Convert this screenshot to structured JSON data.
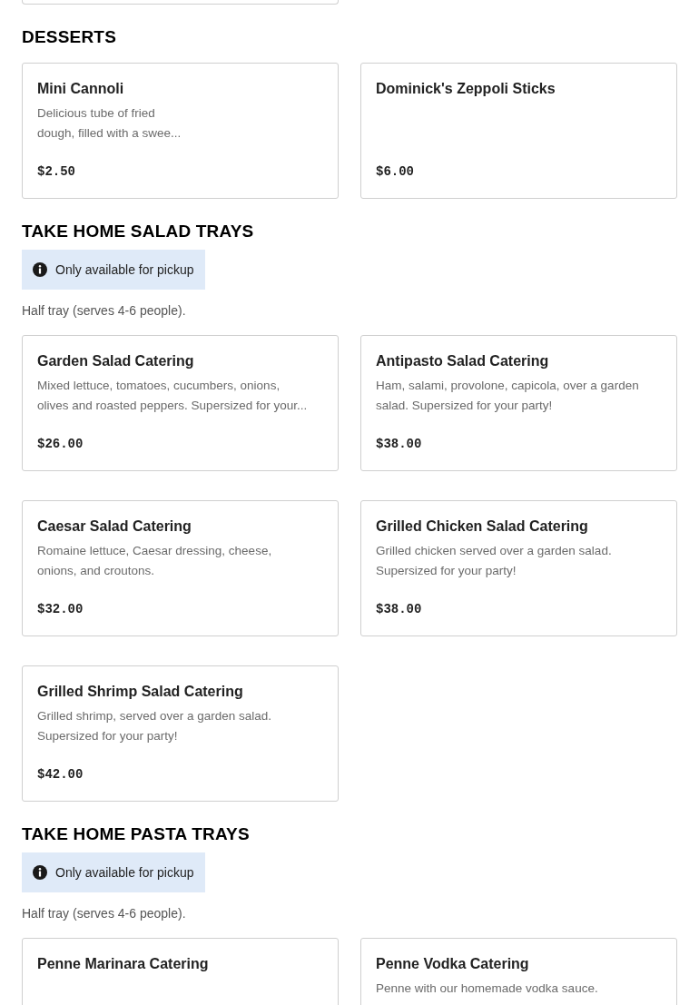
{
  "sections": [
    {
      "title": "DESSERTS",
      "items": [
        {
          "name": "Mini Cannoli",
          "description_lines": [
            "Delicious tube of fried",
            "dough, filled with a swee..."
          ],
          "price": "$2.50"
        },
        {
          "name": "Dominick's Zeppoli Sticks",
          "price": "$6.00"
        }
      ]
    },
    {
      "title": "TAKE HOME SALAD TRAYS",
      "notice": "Only available for pickup",
      "note": "Half tray (serves 4-6 people).",
      "items": [
        {
          "name": "Garden Salad Catering",
          "description_lines": [
            "Mixed lettuce, tomatoes, cucumbers, onions,",
            "olives and roasted peppers. Supersized for your..."
          ],
          "price": "$26.00"
        },
        {
          "name": "Antipasto Salad Catering",
          "description_lines": [
            "Ham, salami, provolone, capicola, over a garden",
            "salad. Supersized for your party!"
          ],
          "price": "$38.00"
        },
        {
          "name": "Caesar Salad Catering",
          "description_lines": [
            "Romaine lettuce, Caesar dressing, cheese,",
            "onions, and croutons."
          ],
          "price": "$32.00"
        },
        {
          "name": "Grilled Chicken Salad Catering",
          "description_lines": [
            "Grilled chicken served over a garden salad.",
            "Supersized for your party!"
          ],
          "price": "$38.00"
        },
        {
          "name": "Grilled Shrimp Salad Catering",
          "description_lines": [
            "Grilled shrimp, served over a garden salad.",
            "Supersized for your party!"
          ],
          "price": "$42.00"
        }
      ]
    },
    {
      "title": "TAKE HOME PASTA TRAYS",
      "notice": "Only available for pickup",
      "note": "Half tray (serves 4-6 people).",
      "items": [
        {
          "name": "Penne Marinara Catering"
        },
        {
          "name": "Penne Vodka Catering",
          "description_lines": [
            "Penne with our homemade vodka sauce."
          ]
        }
      ]
    }
  ]
}
